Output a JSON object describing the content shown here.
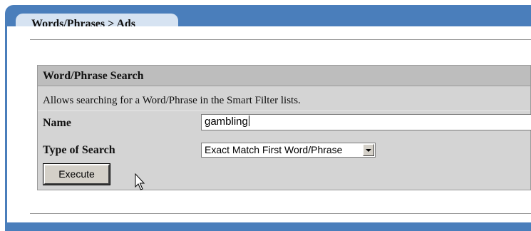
{
  "tab": {
    "label": "Words/Phrases > Ads"
  },
  "search": {
    "title": "Word/Phrase Search",
    "description": "Allows searching for a Word/Phrase in the Smart Filter lists.",
    "name_label": "Name",
    "name_value": "gambling",
    "type_label": "Type of Search",
    "type_selected": "Exact Match First Word/Phrase",
    "execute_label": "Execute"
  },
  "icons": {
    "dropdown": "chevron-down-icon",
    "cursor": "mouse-pointer-icon"
  }
}
